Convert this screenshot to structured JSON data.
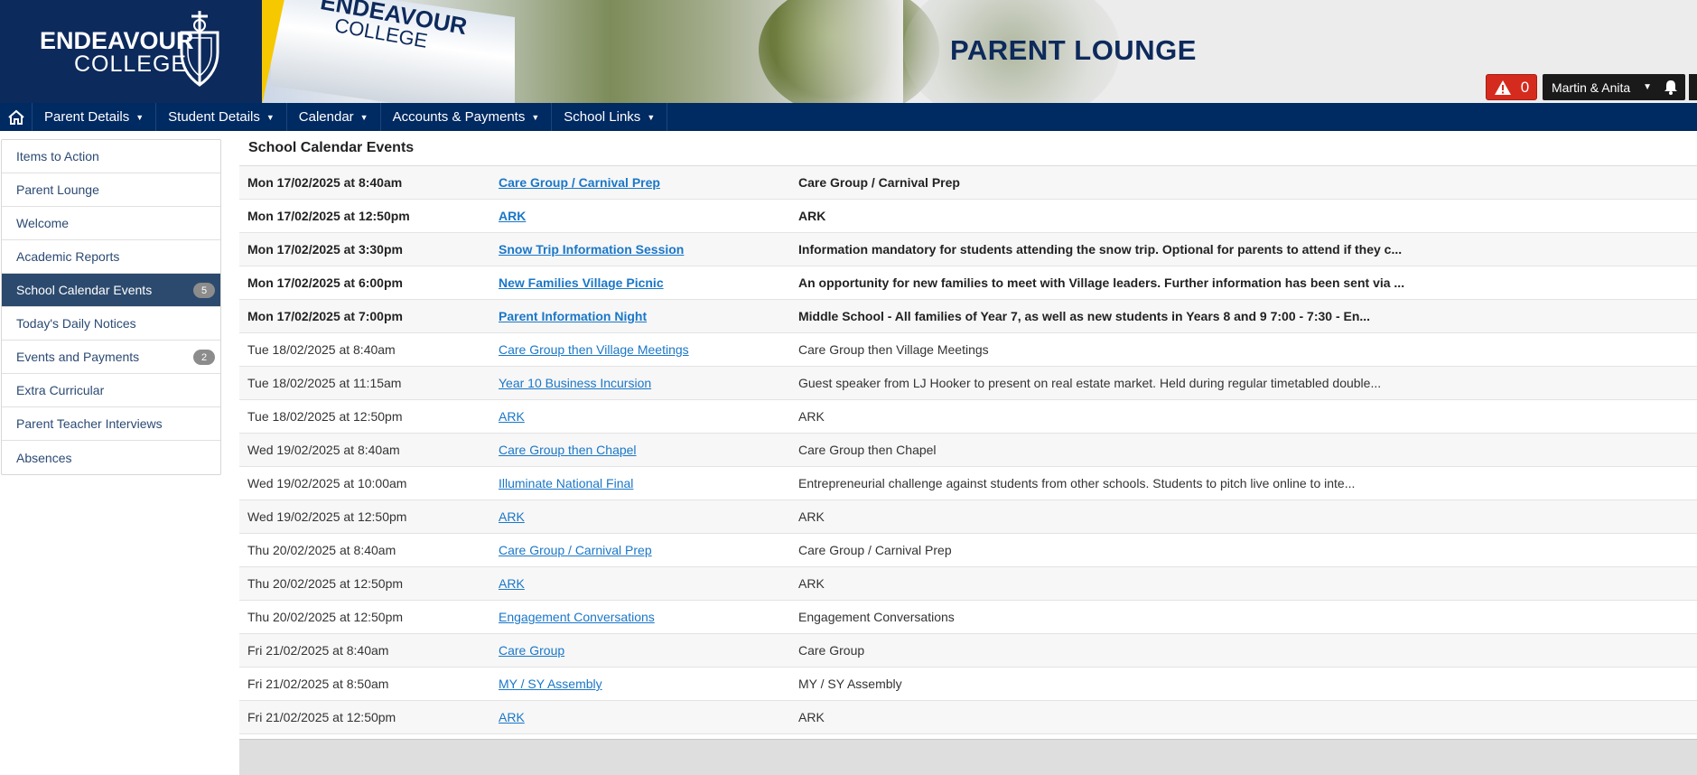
{
  "header": {
    "logo_line1": "ENDEAVOUR",
    "logo_line2": "COLLEGE",
    "banner_line1": "ENDEAVOUR",
    "banner_line2": "COLLEGE",
    "page_title": "PARENT LOUNGE",
    "alert_count": "0",
    "user_name": "Martin & Anita",
    "colors": {
      "brand_navy": "#0d2a5c",
      "nav_bg": "#002a62",
      "alert_red": "#d52b1e",
      "logo_gold": "#f5c800"
    }
  },
  "nav": {
    "home_icon": "home-icon",
    "items": [
      {
        "label": "Parent Details"
      },
      {
        "label": "Student Details"
      },
      {
        "label": "Calendar"
      },
      {
        "label": "Accounts & Payments"
      },
      {
        "label": "School Links"
      }
    ]
  },
  "sidebar": {
    "items": [
      {
        "label": "Items to Action"
      },
      {
        "label": "Parent Lounge"
      },
      {
        "label": "Welcome"
      },
      {
        "label": "Academic Reports"
      },
      {
        "label": "School Calendar Events",
        "badge": "5",
        "active": true
      },
      {
        "label": "Today's Daily Notices"
      },
      {
        "label": "Events and Payments",
        "badge": "2"
      },
      {
        "label": "Extra Curricular"
      },
      {
        "label": "Parent Teacher Interviews"
      },
      {
        "label": "Absences"
      }
    ]
  },
  "content": {
    "title": "School Calendar Events",
    "events": [
      {
        "date": "Mon 17/02/2025 at 8:40am",
        "title": "Care Group / Carnival Prep",
        "desc": "Care Group / Carnival Prep",
        "bold": true
      },
      {
        "date": "Mon 17/02/2025 at 12:50pm",
        "title": "ARK",
        "desc": "ARK",
        "bold": true
      },
      {
        "date": "Mon 17/02/2025 at 3:30pm",
        "title": "Snow Trip Information Session",
        "desc": "Information mandatory for students attending the snow trip. Optional for parents to attend if they c...",
        "bold": true
      },
      {
        "date": "Mon 17/02/2025 at 6:00pm",
        "title": "New Families Village Picnic",
        "desc": "An opportunity for new families to meet with Village leaders. Further information has been sent via ...",
        "bold": true
      },
      {
        "date": "Mon 17/02/2025 at 7:00pm",
        "title": "Parent Information Night",
        "desc": "Middle School - All families of Year 7, as well as new students in Years 8 and 9 7:00 - 7:30 - En...",
        "bold": true
      },
      {
        "date": "Tue 18/02/2025 at 8:40am",
        "title": "Care Group then Village Meetings",
        "desc": "Care Group then Village Meetings",
        "bold": false
      },
      {
        "date": "Tue 18/02/2025 at 11:15am",
        "title": "Year 10 Business Incursion",
        "desc": "Guest speaker from LJ Hooker to present on real estate market. Held during regular timetabled double...",
        "bold": false
      },
      {
        "date": "Tue 18/02/2025 at 12:50pm",
        "title": "ARK",
        "desc": "ARK",
        "bold": false
      },
      {
        "date": "Wed 19/02/2025 at 8:40am",
        "title": "Care Group then Chapel",
        "desc": "Care Group then Chapel",
        "bold": false
      },
      {
        "date": "Wed 19/02/2025 at 10:00am",
        "title": "Illuminate National Final",
        "desc": "Entrepreneurial challenge against students from other schools. Students to pitch live online to inte...",
        "bold": false
      },
      {
        "date": "Wed 19/02/2025 at 12:50pm",
        "title": "ARK",
        "desc": "ARK",
        "bold": false
      },
      {
        "date": "Thu 20/02/2025 at 8:40am",
        "title": "Care Group / Carnival Prep",
        "desc": "Care Group / Carnival Prep",
        "bold": false
      },
      {
        "date": "Thu 20/02/2025 at 12:50pm",
        "title": "ARK",
        "desc": "ARK",
        "bold": false
      },
      {
        "date": "Thu 20/02/2025 at 12:50pm",
        "title": "Engagement Conversations",
        "desc": "Engagement Conversations",
        "bold": false
      },
      {
        "date": "Fri 21/02/2025 at 8:40am",
        "title": "Care Group",
        "desc": "Care Group",
        "bold": false
      },
      {
        "date": "Fri 21/02/2025 at 8:50am",
        "title": "MY / SY Assembly",
        "desc": "MY / SY Assembly",
        "bold": false
      },
      {
        "date": "Fri 21/02/2025 at 12:50pm",
        "title": "ARK",
        "desc": "ARK",
        "bold": false
      }
    ]
  }
}
